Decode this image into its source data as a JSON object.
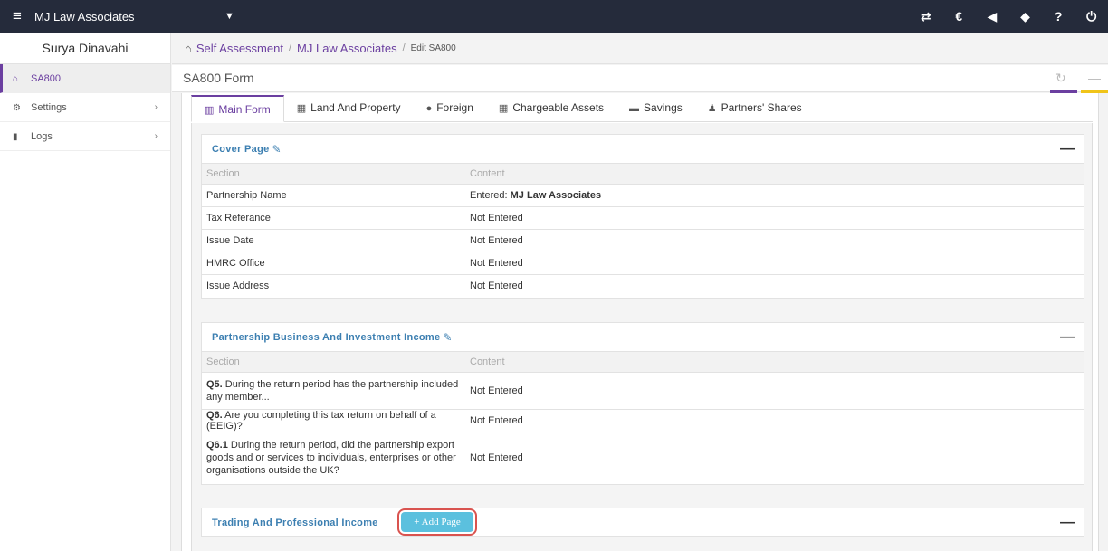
{
  "topbar": {
    "brand": "MJ Law Associates",
    "menu_icon": "hamburger-icon",
    "dropdown_icon": "chevron-down-icon",
    "actions": [
      {
        "name": "transfer-icon",
        "glyph": "⇄"
      },
      {
        "name": "currency-icon",
        "glyph": "€"
      },
      {
        "name": "megaphone-icon",
        "glyph": "📢"
      },
      {
        "name": "ticket-icon",
        "glyph": "✈"
      },
      {
        "name": "help-icon",
        "glyph": "?"
      },
      {
        "name": "power-icon",
        "glyph": "⏻"
      }
    ]
  },
  "sidebar": {
    "user": "Surya Dinavahi",
    "items": [
      {
        "label": "SA800",
        "icon": "home-icon"
      },
      {
        "label": "Settings",
        "icon": "gear-icon"
      },
      {
        "label": "Logs",
        "icon": "file-icon"
      }
    ]
  },
  "breadcrumb": {
    "items": [
      "Self Assessment",
      "MJ Law Associates"
    ],
    "current": "Edit SA800"
  },
  "page": {
    "title": "SA800 Form"
  },
  "tabs": [
    {
      "label": "Main Form",
      "icon": "bar-chart-icon"
    },
    {
      "label": "Land And Property",
      "icon": "building-icon"
    },
    {
      "label": "Foreign",
      "icon": "globe-icon"
    },
    {
      "label": "Chargeable Assets",
      "icon": "building-icon"
    },
    {
      "label": "Savings",
      "icon": "briefcase-icon"
    },
    {
      "label": "Partners' Shares",
      "icon": "users-icon"
    }
  ],
  "cover": {
    "title": "Cover Page",
    "col_section": "Section",
    "col_content": "Content",
    "rows": [
      {
        "section": "Partnership Name",
        "prefix": "Entered: ",
        "value": "MJ Law Associates"
      },
      {
        "section": "Tax Referance",
        "content": "Not Entered"
      },
      {
        "section": "Issue Date",
        "content": "Not Entered"
      },
      {
        "section": "HMRC Office",
        "content": "Not Entered"
      },
      {
        "section": "Issue Address",
        "content": "Not Entered"
      }
    ]
  },
  "business": {
    "title": "Partnership Business And Investment Income",
    "col_section": "Section",
    "col_content": "Content",
    "rows": [
      {
        "q": "Q5.",
        "text": " During the return period has the partnership included any member...",
        "content": "Not Entered"
      },
      {
        "q": "Q6.",
        "text": " Are you completing this tax return on behalf of a (EEIG)?",
        "content": "Not Entered"
      },
      {
        "q": "Q6.1",
        "text": " During the return period, did the partnership export goods and or services to individuals, enterprises or other organisations outside the UK?",
        "content": "Not Entered"
      }
    ]
  },
  "trading": {
    "title": "Trading And Professional Income",
    "add_label": "+ Add Page"
  }
}
